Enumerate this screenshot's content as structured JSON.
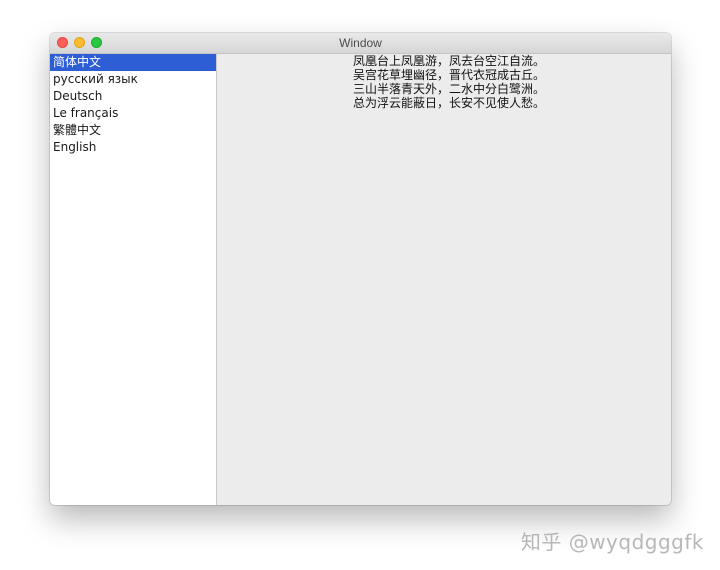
{
  "window": {
    "title": "Window"
  },
  "sidebar": {
    "items": [
      {
        "label": "简体中文",
        "selected": true
      },
      {
        "label": "русский язык",
        "selected": false
      },
      {
        "label": "Deutsch",
        "selected": false
      },
      {
        "label": "Le français",
        "selected": false
      },
      {
        "label": "繁體中文",
        "selected": false
      },
      {
        "label": "English",
        "selected": false
      }
    ]
  },
  "content": {
    "lines": [
      "凤凰台上凤凰游，凤去台空江自流。",
      "吴宫花草埋幽径，晋代衣冠成古丘。",
      "三山半落青天外，二水中分白鹭洲。",
      "总为浮云能蔽日，长安不见使人愁。"
    ]
  },
  "watermark": {
    "text": "知乎 @wyqdgggfk"
  },
  "colors": {
    "selection": "#2e5ed6",
    "close": "#ff5f57",
    "minimize": "#febc2e",
    "maximize": "#28c840"
  }
}
